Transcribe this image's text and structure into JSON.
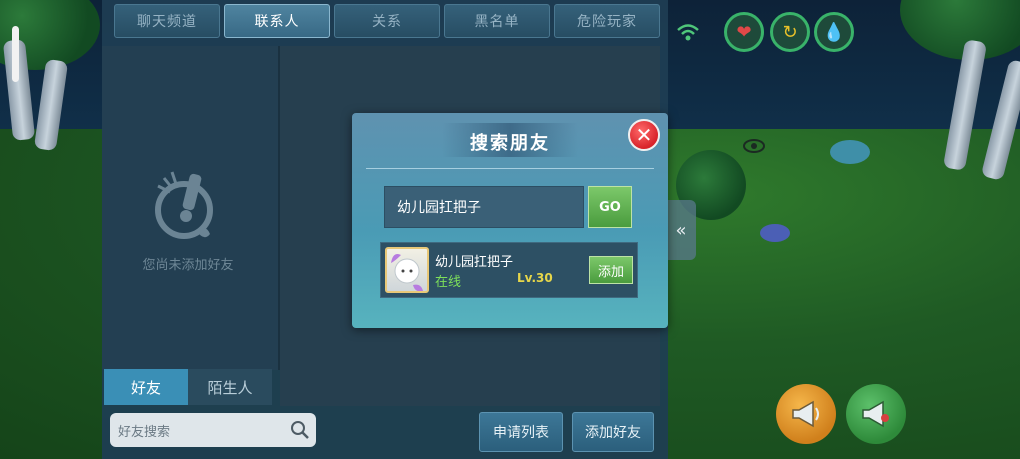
{
  "top_tabs": [
    {
      "label": "聊天频道",
      "active": false
    },
    {
      "label": "联系人",
      "active": true
    },
    {
      "label": "关系",
      "active": false
    },
    {
      "label": "黑名单",
      "active": false
    },
    {
      "label": "危险玩家",
      "active": false
    }
  ],
  "empty_state": {
    "text": "您尚未添加好友"
  },
  "bottom_tabs": [
    {
      "label": "好友",
      "active": true
    },
    {
      "label": "陌生人",
      "active": false
    }
  ],
  "search": {
    "placeholder": "好友搜索"
  },
  "buttons": {
    "apply_list": "申请列表",
    "add_friend": "添加好友"
  },
  "modal": {
    "title": "搜索朋友",
    "input_value": "幼儿园扛把子",
    "go_label": "GO",
    "result": {
      "name": "幼儿园扛把子",
      "status": "在线",
      "level": "Lv.30",
      "add_label": "添加"
    }
  },
  "colors": {
    "accent_green": "#4a9c3e",
    "status_online": "#7ee05a",
    "level_yellow": "#e6d64a",
    "close_red": "#d8232a"
  }
}
